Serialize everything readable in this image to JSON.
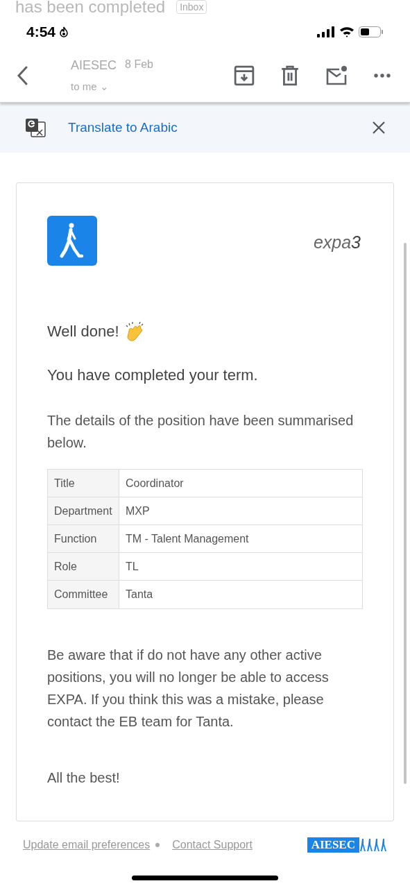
{
  "background": {
    "subject": "has been completed",
    "label": "Inbox",
    "sender": "AIESEC",
    "date": "8 Feb",
    "recipient": "to me ⌄"
  },
  "status_bar": {
    "time": "4:54"
  },
  "translate_bar": {
    "link": "Translate to Arabic"
  },
  "email": {
    "brand": {
      "name": "expa",
      "suffix": "3"
    },
    "greeting": "Well done!",
    "headline": "You have completed your term.",
    "intro": "The details of the position have been summarised below.",
    "table": {
      "rows": [
        {
          "label": "Title",
          "value": "Coordinator"
        },
        {
          "label": "Department",
          "value": "MXP"
        },
        {
          "label": "Function",
          "value": "TM - Talent Management"
        },
        {
          "label": "Role",
          "value": "TL"
        },
        {
          "label": "Committee",
          "value": "Tanta"
        }
      ]
    },
    "notice": "Be aware that if do not have any other active positions, you will no longer be able to access EXPA. If you think this was a mistake, please contact the EB team for Tanta.",
    "signoff": "All the best!"
  },
  "footer": {
    "links": [
      "Update email preferences",
      "Contact Support"
    ],
    "logo": "AIESEC"
  }
}
